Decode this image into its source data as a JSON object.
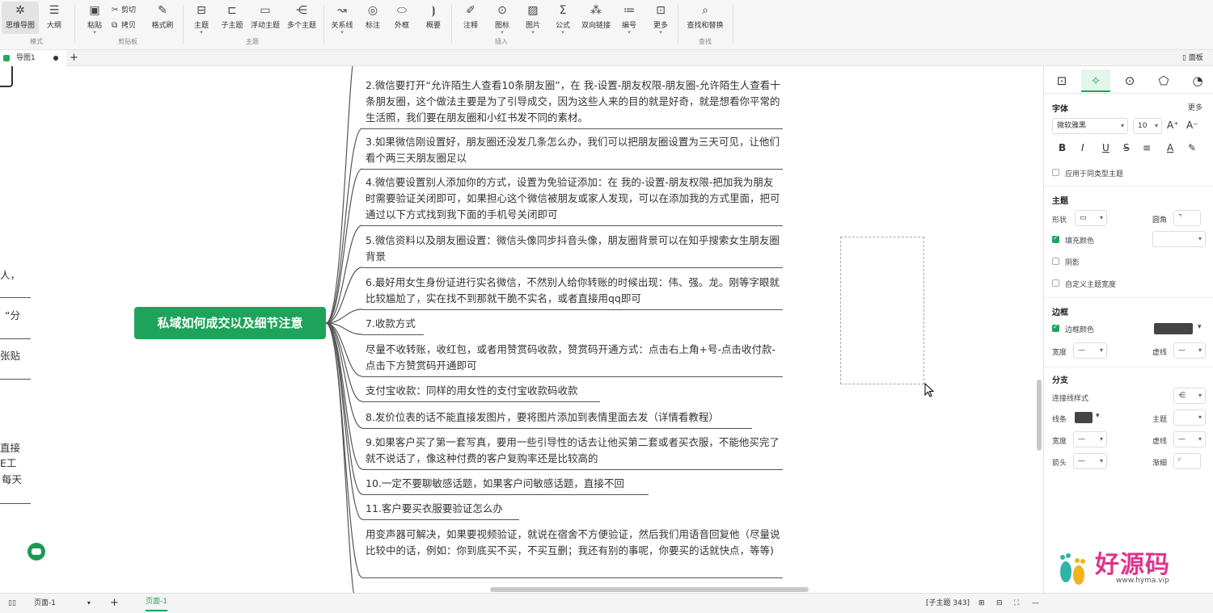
{
  "toolbar": {
    "mode": {
      "mindmap": "思维导图",
      "outline": "大纲",
      "group": "模式"
    },
    "clipboard": {
      "paste": "粘贴",
      "cut": "剪切",
      "copy": "拷贝",
      "format_brush": "格式刷",
      "group": "剪贴板"
    },
    "topic": {
      "topic": "主题",
      "subtopic": "子主题",
      "floating": "浮动主题",
      "multi": "多个主题",
      "group": "主题"
    },
    "insert": {
      "relation": "关系线",
      "label": "标注",
      "frame": "外框",
      "summary": "概要",
      "note": "注释",
      "icon": "图标",
      "image": "图片",
      "formula": "公式",
      "bilink": "双向链接",
      "number": "编号",
      "more": "更多",
      "group": "插入"
    },
    "find": {
      "find_replace": "查找和替换",
      "group": "查找"
    }
  },
  "tabs": {
    "doc": "导图1",
    "add": "+",
    "panel": "面板"
  },
  "canvas": {
    "root": "私域如何成交以及细节注意",
    "nodes": [
      {
        "text": "2.微信要打开“允许陌生人查看10条朋友圈”，在 我-设置-朋友权限-朋友圈-允许陌生人查看十条朋友圈，这个做法主要是为了引导成交，因为这些人来的目的就是好奇，就是想看你平常的生活照，我们要在朋友圈和小红书发不同的素材。"
      },
      {
        "text": "3.如果微信刚设置好，朋友圈还没发几条怎么办，我们可以把朋友圈设置为三天可见，让他们看个两三天朋友圈足以"
      },
      {
        "text": "4.微信要设置别人添加你的方式，设置为免验证添加：在 我的-设置-朋友权限-把加我为朋友时需要验证关闭即可，如果担心这个微信被朋友或家人发现，可以在添加我的方式里面，把可通过以下方式找到我下面的手机号关闭即可"
      },
      {
        "text": "5.微信资料以及朋友圈设置：微信头像同步抖音头像，朋友圈背景可以在知乎搜索女生朋友圈背景"
      },
      {
        "text": "6.最好用女生身份证进行实名微信，不然别人给你转账的时候出现：伟、强。龙。刚等字眼就比较尴尬了，实在找不到那就干脆不实名，或者直接用qq即可"
      },
      {
        "text": "7.收款方式"
      },
      {
        "text": "尽量不收转账，收红包，或者用赞赏码收款，赞赏码开通方式：点击右上角+号-点击收付款-点击下方赞赏码开通即可"
      },
      {
        "text": "支付宝收款：同样的用女性的支付宝收款码收款"
      },
      {
        "text": "8.发价位表的话不能直接发图片，要将图片添加到表情里面去发（详情看教程）"
      },
      {
        "text": "9.如果客户买了第一套写真，要用一些引导性的话去让他买第二套或者买衣服，不能他买完了就不说话了，像这种付费的客户复购率还是比较高的"
      },
      {
        "text": "10.一定不要聊敏感话题，如果客户问敏感话题，直接不回"
      },
      {
        "text": "11.客户要买衣服要验证怎么办"
      },
      {
        "text": "用变声器可解决，如果要视频验证，就说在宿舍不方便验证，然后我们用语音回复他（尽量说比较中的话，例如：你到底买不买，不买互删；我还有别的事呢，你要买的话就快点，等等)"
      }
    ],
    "left_fragments": [
      "人，",
      "“分",
      "张贴",
      "直接",
      "E工",
      "每天"
    ]
  },
  "panel": {
    "font": {
      "title": "字体",
      "more": "更多",
      "family": "微软雅黑",
      "size": "10",
      "apply_same": "应用于同类型主题"
    },
    "topic": {
      "title": "主题",
      "shape": "形状",
      "corner": "圆角",
      "fill": "填充颜色",
      "shadow": "阴影",
      "custom_width": "自定义主题宽度"
    },
    "border": {
      "title": "边框",
      "color": "边框颜色",
      "width": "宽度",
      "dash": "虚线",
      "color_hex": "#444444"
    },
    "branch": {
      "title": "分支",
      "line_style": "连接线样式",
      "line": "线条",
      "topic": "主题",
      "width": "宽度",
      "dash": "虚线",
      "arrow": "箭头",
      "taper": "渐细"
    }
  },
  "statusbar": {
    "page_select": "页面-1",
    "add": "+",
    "page_tab": "页面-1",
    "count": "[子主题 343]"
  },
  "watermark": {
    "title": "好源码",
    "url": "www.hyma.vip"
  },
  "colors": {
    "accent": "#1ea35b",
    "watermark": "#e0348c"
  }
}
